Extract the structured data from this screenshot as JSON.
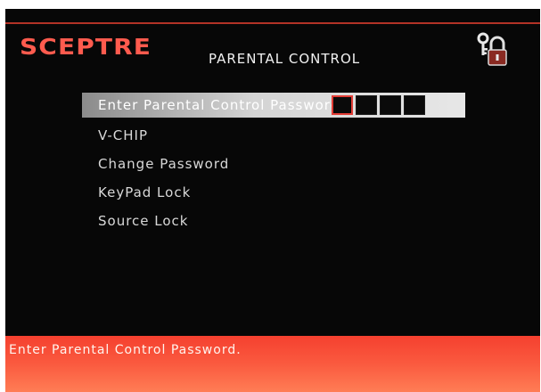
{
  "header": {
    "brand": "SCEPTRE",
    "title": "PARENTAL CONTROL",
    "icon": "lock-key-icon"
  },
  "menu": {
    "items": [
      {
        "label": "Enter Parental Control Password",
        "selected": true
      },
      {
        "label": "V-CHIP"
      },
      {
        "label": "Change Password"
      },
      {
        "label": "KeyPad Lock"
      },
      {
        "label": "Source Lock"
      }
    ],
    "password_digits": 4,
    "active_digit": 1
  },
  "status": {
    "message": "Enter Parental Control Password."
  },
  "colors": {
    "brand": "#ff5b4e",
    "status_bar": "#fa5a3f",
    "selection": "#d4d4d4",
    "background": "#070707"
  }
}
